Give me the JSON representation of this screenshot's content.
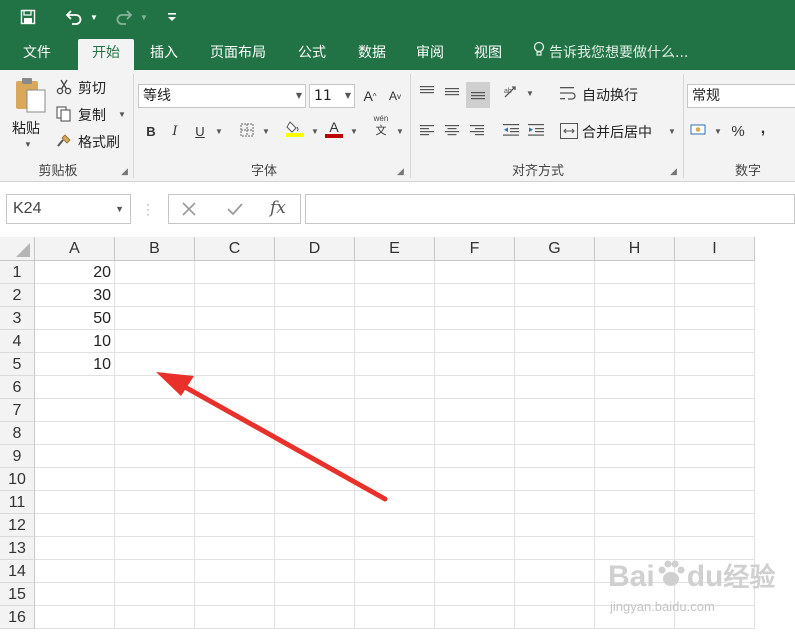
{
  "title_bar": {
    "icons": [
      "save-icon",
      "undo-icon",
      "redo-icon",
      "customize-quick-access-icon"
    ]
  },
  "tabs": [
    {
      "label": "文件",
      "active": false
    },
    {
      "label": "开始",
      "active": true
    },
    {
      "label": "插入",
      "active": false
    },
    {
      "label": "页面布局",
      "active": false
    },
    {
      "label": "公式",
      "active": false
    },
    {
      "label": "数据",
      "active": false
    },
    {
      "label": "审阅",
      "active": false
    },
    {
      "label": "视图",
      "active": false
    }
  ],
  "tell_me": "告诉我您想要做什么...",
  "ribbon": {
    "clipboard": {
      "paste": "粘贴",
      "cut": "剪切",
      "copy": "复制",
      "format_painter": "格式刷",
      "group_label": "剪贴板"
    },
    "font": {
      "font_name": "等线",
      "font_size": "11",
      "bold": "B",
      "italic": "I",
      "underline": "U",
      "font_color_letter": "A",
      "phonetic": "wén",
      "phonetic_char": "文",
      "grow": "A",
      "shrink": "A",
      "group_label": "字体"
    },
    "alignment": {
      "wrap_text": "自动换行",
      "merge_center": "合并后居中",
      "group_label": "对齐方式"
    },
    "number": {
      "format": "常规",
      "percent": "%",
      "comma": ",",
      "group_label": "数字"
    }
  },
  "formula_bar": {
    "name_box": "K24",
    "fx": "fx",
    "formula": ""
  },
  "sheet": {
    "columns": [
      "A",
      "B",
      "C",
      "D",
      "E",
      "F",
      "G",
      "H",
      "I"
    ],
    "rows": [
      "1",
      "2",
      "3",
      "4",
      "5",
      "6",
      "7",
      "8",
      "9",
      "10",
      "11",
      "12",
      "13",
      "14",
      "15",
      "16"
    ],
    "column_a_values": [
      "20",
      "30",
      "50",
      "10",
      "10"
    ]
  },
  "watermark": {
    "brand": "Bai",
    "brand2": "du",
    "jingyan": "经验",
    "url": "jingyan.baidu.com"
  },
  "colors": {
    "excel_green": "#217346",
    "ribbon_bg": "#f3f3f3",
    "arrow_red": "#e8312a",
    "fill_highlight": "#ffff00",
    "font_color_bar": "#c00000"
  }
}
